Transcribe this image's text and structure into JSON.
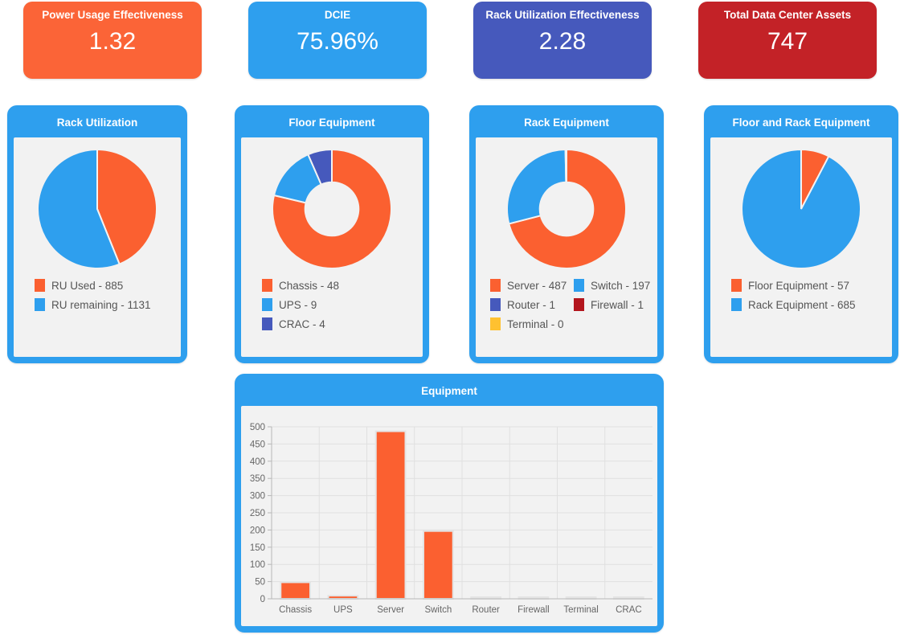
{
  "colors": {
    "orange": "#fb6030",
    "blue": "#2e9fee",
    "purple": "#4659bc",
    "red": "#c32227",
    "yellow": "#ffc130",
    "card_border": "#2e9fee",
    "card_body": "#f2f2f2",
    "legend_text": "#555555"
  },
  "kpis": [
    {
      "title": "Power Usage Effectiveness",
      "value": "1.32",
      "color": "#fb6437"
    },
    {
      "title": "DCIE",
      "value": "75.96%",
      "color": "#2e9fee"
    },
    {
      "title": "Rack Utilization Effectiveness",
      "value": "2.28",
      "color": "#4659bc"
    },
    {
      "title": "Total Data Center Assets",
      "value": "747",
      "color": "#c32227"
    }
  ],
  "cards": [
    {
      "title": "Rack Utilization"
    },
    {
      "title": "Floor Equipment"
    },
    {
      "title": "Rack Equipment"
    },
    {
      "title": "Floor and Rack Equipment"
    },
    {
      "title": "Equipment"
    }
  ],
  "chart_data": [
    {
      "type": "pie",
      "title": "Rack Utilization",
      "legend_position": "bottom-left",
      "legend_columns": 1,
      "categories": [
        "RU Used",
        "RU remaining"
      ],
      "values": [
        885,
        1131
      ],
      "labels": [
        "RU Used - 885",
        "RU remaining - 1131"
      ],
      "colors": [
        "#fb6030",
        "#2e9fee"
      ]
    },
    {
      "type": "pie",
      "variant": "donut",
      "title": "Floor Equipment",
      "legend_position": "bottom-left",
      "legend_columns": 1,
      "categories": [
        "Chassis",
        "UPS",
        "CRAC"
      ],
      "values": [
        48,
        9,
        4
      ],
      "labels": [
        "Chassis - 48",
        "UPS - 9",
        "CRAC - 4"
      ],
      "colors": [
        "#fb6030",
        "#2e9fee",
        "#4659bc"
      ]
    },
    {
      "type": "pie",
      "variant": "donut",
      "title": "Rack Equipment",
      "legend_position": "bottom-left",
      "legend_columns": 2,
      "categories": [
        "Server",
        "Switch",
        "Router",
        "Firewall",
        "Terminal"
      ],
      "values": [
        487,
        197,
        1,
        1,
        0
      ],
      "labels": [
        "Server - 487",
        "Switch - 197",
        "Router - 1",
        "Firewall - 1",
        "Terminal - 0"
      ],
      "colors": [
        "#fb6030",
        "#2e9fee",
        "#4659bc",
        "#b3151d",
        "#ffc130"
      ]
    },
    {
      "type": "pie",
      "title": "Floor and Rack Equipment",
      "legend_position": "bottom-left",
      "legend_columns": 1,
      "categories": [
        "Floor Equipment",
        "Rack Equipment"
      ],
      "values": [
        57,
        685
      ],
      "labels": [
        "Floor Equipment - 57",
        "Rack Equipment - 685"
      ],
      "colors": [
        "#fb6030",
        "#2e9fee"
      ]
    },
    {
      "type": "bar",
      "title": "Equipment",
      "categories": [
        "Chassis",
        "UPS",
        "Server",
        "Switch",
        "Router",
        "Firewall",
        "Terminal",
        "CRAC"
      ],
      "values": [
        48,
        9,
        487,
        197,
        1,
        1,
        0,
        4
      ],
      "xlabel": "",
      "ylabel": "",
      "ylim": [
        0,
        500
      ],
      "yticks": [
        0,
        50,
        100,
        150,
        200,
        250,
        300,
        350,
        400,
        450,
        500
      ],
      "grid": true,
      "bar_color": "#fb6030",
      "legend": false
    }
  ]
}
